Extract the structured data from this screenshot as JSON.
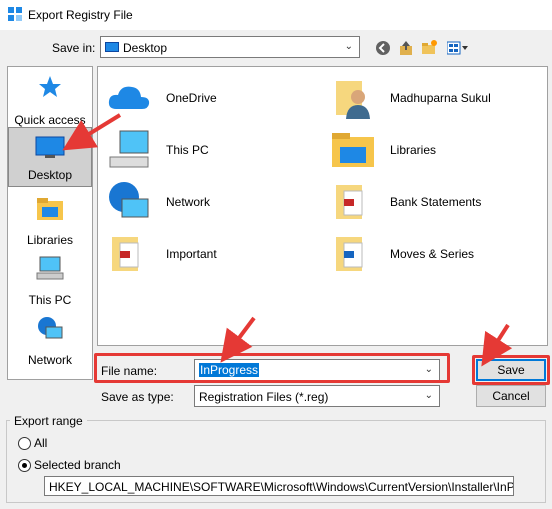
{
  "window": {
    "title": "Export Registry File"
  },
  "save_in": {
    "label": "Save in:",
    "value": "Desktop"
  },
  "toolbar": {
    "back_icon": "back-arrow-icon",
    "up_icon": "up-folder-icon",
    "new_folder_icon": "new-folder-icon",
    "view_icon": "view-menu-icon"
  },
  "places": [
    {
      "label": "Quick access",
      "icon": "star-icon"
    },
    {
      "label": "Desktop",
      "icon": "desktop-icon",
      "selected": true
    },
    {
      "label": "Libraries",
      "icon": "libraries-icon"
    },
    {
      "label": "This PC",
      "icon": "computer-icon"
    },
    {
      "label": "Network",
      "icon": "network-icon"
    }
  ],
  "files": [
    {
      "label": "OneDrive",
      "icon": "onedrive-cloud-icon"
    },
    {
      "label": "Madhuparna Sukul",
      "icon": "user-folder-icon"
    },
    {
      "label": "This PC",
      "icon": "computer-icon"
    },
    {
      "label": "Libraries",
      "icon": "libraries-icon"
    },
    {
      "label": "Network",
      "icon": "network-icon"
    },
    {
      "label": "Bank Statements",
      "icon": "pdf-folder-icon"
    },
    {
      "label": "Important",
      "icon": "pdf-folder-icon"
    },
    {
      "label": "Moves & Series",
      "icon": "pdf-folder-icon"
    }
  ],
  "file_name": {
    "label": "File name:",
    "value": "InProgress"
  },
  "save_as_type": {
    "label": "Save as type:",
    "value": "Registration Files (*.reg)"
  },
  "buttons": {
    "save": "Save",
    "cancel": "Cancel"
  },
  "export_range": {
    "title": "Export range",
    "all_label": "All",
    "selected_label": "Selected branch",
    "selected": "Selected branch",
    "branch_path": "HKEY_LOCAL_MACHINE\\SOFTWARE\\Microsoft\\Windows\\CurrentVersion\\Installer\\InProgress"
  },
  "colors": {
    "annotation_red": "#e53935",
    "selection_blue": "#0078d7",
    "accent": "#1e88e5"
  }
}
